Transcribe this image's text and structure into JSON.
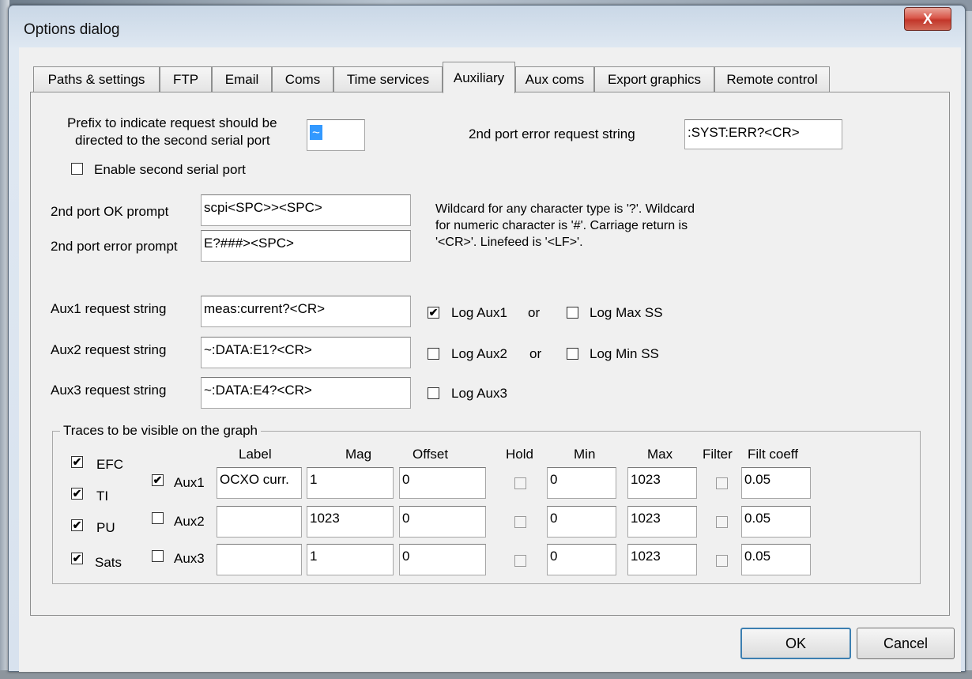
{
  "window": {
    "title": "Options dialog",
    "close_label": "X"
  },
  "tabs": [
    "Paths & settings",
    "FTP",
    "Email",
    "Coms",
    "Time services",
    "Auxiliary",
    "Aux coms",
    "Export graphics",
    "Remote control"
  ],
  "active_tab": "Auxiliary",
  "second_port": {
    "prefix_label_line1": "Prefix to indicate request should be",
    "prefix_label_line2": "directed to the second serial port",
    "prefix_value": "~",
    "enable_label": "Enable second serial port",
    "enable_checked": false,
    "error_request_label": "2nd port error request string",
    "error_request_value": ":SYST:ERR?<CR>",
    "ok_prompt_label": "2nd port OK prompt",
    "ok_prompt_value": "scpi<SPC>><SPC>",
    "error_prompt_label": "2nd port error prompt",
    "error_prompt_value": "E?###><SPC>",
    "wildcard_line1": "Wildcard for any character type is '?'. Wildcard",
    "wildcard_line2": "for numeric character is '#'. Carriage return is",
    "wildcard_line3": "'<CR>'. Linefeed is '<LF>'."
  },
  "aux_requests": [
    {
      "label": "Aux1 request string",
      "value": "meas:current?<CR>",
      "log_label": "Log Aux1",
      "log_checked": true,
      "or": "or",
      "alt_label": "Log Max SS",
      "alt_checked": false
    },
    {
      "label": "Aux2 request string",
      "value": "~:DATA:E1?<CR>",
      "log_label": "Log Aux2",
      "log_checked": false,
      "or": "or",
      "alt_label": "Log Min SS",
      "alt_checked": false
    },
    {
      "label": "Aux3 request string",
      "value": "~:DATA:E4?<CR>",
      "log_label": "Log Aux3",
      "log_checked": false
    }
  ],
  "traces": {
    "title": "Traces to be visible on the graph",
    "left_checks": [
      {
        "label": "EFC",
        "checked": true
      },
      {
        "label": "TI",
        "checked": true
      },
      {
        "label": "PU",
        "checked": true
      },
      {
        "label": "Sats",
        "checked": true
      }
    ],
    "headers": {
      "label": "Label",
      "mag": "Mag",
      "offset": "Offset",
      "hold": "Hold",
      "min": "Min",
      "max": "Max",
      "filter": "Filter",
      "filt_coeff": "Filt coeff"
    },
    "rows": [
      {
        "name": "Aux1",
        "checked": true,
        "label": "OCXO curr.",
        "mag": "1",
        "offset": "0",
        "hold": false,
        "min": "0",
        "max": "1023",
        "filter": false,
        "coeff": "0.05"
      },
      {
        "name": "Aux2",
        "checked": false,
        "label": "",
        "mag": "1023",
        "offset": "0",
        "hold": false,
        "min": "0",
        "max": "1023",
        "filter": false,
        "coeff": "0.05"
      },
      {
        "name": "Aux3",
        "checked": false,
        "label": "",
        "mag": "1",
        "offset": "0",
        "hold": false,
        "min": "0",
        "max": "1023",
        "filter": false,
        "coeff": "0.05"
      }
    ]
  },
  "buttons": {
    "ok": "OK",
    "cancel": "Cancel"
  },
  "check_glyph": "✔"
}
